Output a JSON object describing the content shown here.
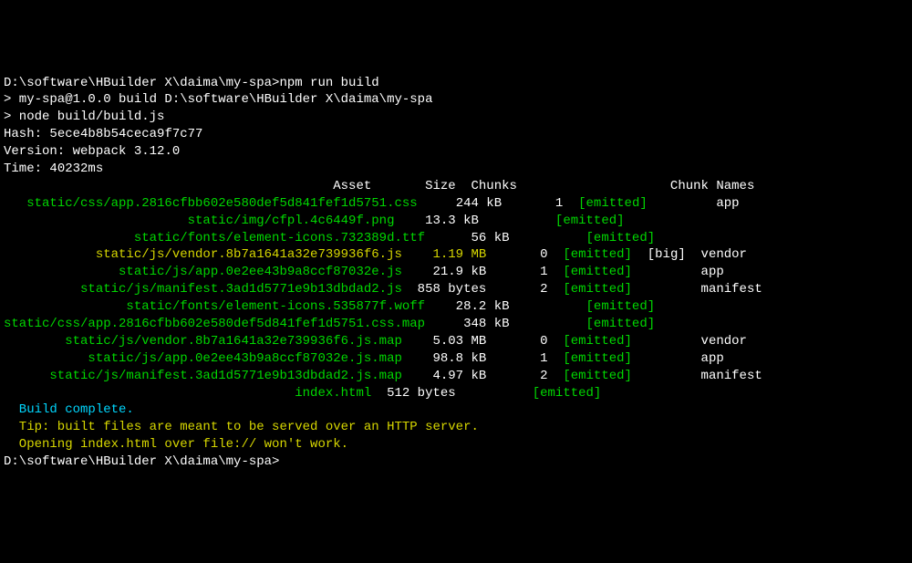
{
  "prompt1": "D:\\software\\HBuilder X\\daima\\my-spa>npm run build",
  "blank1": "",
  "line1": "> my-spa@1.0.0 build D:\\software\\HBuilder X\\daima\\my-spa",
  "line2": "> node build/build.js",
  "blank2": "",
  "hash_label": "Hash: ",
  "hash_value": "5ece4b8b54ceca9f7c77",
  "version_label": "Version: ",
  "version_value": "webpack 3.12.0",
  "time_label": "Time: ",
  "time_value": "40232ms",
  "header": {
    "asset": "                                           Asset",
    "size": "       Size",
    "chunks": "  Chunks",
    "spacer": "             ",
    "names": "       Chunk Names"
  },
  "rows": [
    {
      "asset": "   static/css/app.2816cfbb602e580def5d841fef1d5751.css",
      "size": "     244 kB",
      "chunks": "       1",
      "emitted": "  [emitted]",
      "big": "       ",
      "name": "  app",
      "assetColor": "green",
      "sizeColor": ""
    },
    {
      "asset": "                        static/img/cfpl.4c6449f.png",
      "size": "    13.3 kB",
      "chunks": "        ",
      "emitted": "  [emitted]",
      "big": "       ",
      "name": "",
      "assetColor": "green",
      "sizeColor": ""
    },
    {
      "asset": "                 static/fonts/element-icons.732389d.ttf",
      "size": "      56 kB",
      "chunks": "        ",
      "emitted": "  [emitted]",
      "big": "       ",
      "name": "",
      "assetColor": "green",
      "sizeColor": ""
    },
    {
      "asset": "            static/js/vendor.8b7a1641a32e739936f6.js",
      "size": "    1.19 MB",
      "chunks": "       0",
      "emitted": "  [emitted]",
      "big": "  [big]",
      "name": "  vendor",
      "assetColor": "yellow",
      "sizeColor": "yellow"
    },
    {
      "asset": "               static/js/app.0e2ee43b9a8ccf87032e.js",
      "size": "    21.9 kB",
      "chunks": "       1",
      "emitted": "  [emitted]",
      "big": "       ",
      "name": "  app",
      "assetColor": "green",
      "sizeColor": ""
    },
    {
      "asset": "          static/js/manifest.3ad1d5771e9b13dbdad2.js",
      "size": "  858 bytes",
      "chunks": "       2",
      "emitted": "  [emitted]",
      "big": "       ",
      "name": "  manifest",
      "assetColor": "green",
      "sizeColor": ""
    },
    {
      "asset": "                static/fonts/element-icons.535877f.woff",
      "size": "    28.2 kB",
      "chunks": "        ",
      "emitted": "  [emitted]",
      "big": "       ",
      "name": "",
      "assetColor": "green",
      "sizeColor": ""
    },
    {
      "asset": "static/css/app.2816cfbb602e580def5d841fef1d5751.css.map",
      "size": "     348 kB",
      "chunks": "        ",
      "emitted": "  [emitted]",
      "big": "       ",
      "name": "",
      "assetColor": "green",
      "sizeColor": ""
    },
    {
      "asset": "        static/js/vendor.8b7a1641a32e739936f6.js.map",
      "size": "    5.03 MB",
      "chunks": "       0",
      "emitted": "  [emitted]",
      "big": "       ",
      "name": "  vendor",
      "assetColor": "green",
      "sizeColor": ""
    },
    {
      "asset": "           static/js/app.0e2ee43b9a8ccf87032e.js.map",
      "size": "    98.8 kB",
      "chunks": "       1",
      "emitted": "  [emitted]",
      "big": "       ",
      "name": "  app",
      "assetColor": "green",
      "sizeColor": ""
    },
    {
      "asset": "      static/js/manifest.3ad1d5771e9b13dbdad2.js.map",
      "size": "    4.97 kB",
      "chunks": "       2",
      "emitted": "  [emitted]",
      "big": "       ",
      "name": "  manifest",
      "assetColor": "green",
      "sizeColor": ""
    },
    {
      "asset": "                                      index.html",
      "size": "  512 bytes",
      "chunks": "        ",
      "emitted": "  [emitted]",
      "big": "       ",
      "name": "",
      "assetColor": "green",
      "sizeColor": ""
    }
  ],
  "blank3": "",
  "build_complete": "  Build complete.",
  "blank4": "",
  "tip1": "  Tip: built files are meant to be served over an HTTP server.",
  "tip2": "  Opening index.html over file:// won't work.",
  "blank5": "",
  "blank6": "",
  "prompt2": "D:\\software\\HBuilder X\\daima\\my-spa>"
}
